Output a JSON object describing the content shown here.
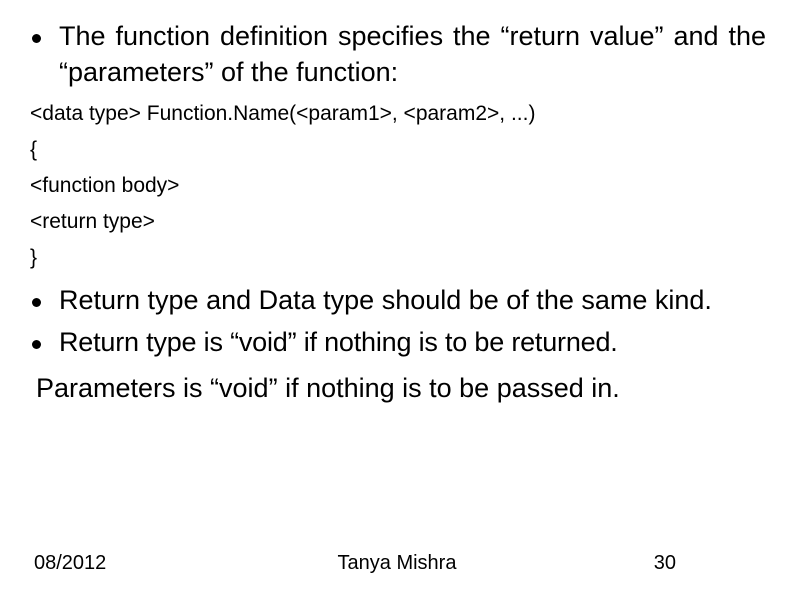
{
  "bullets": {
    "b1": "The function definition specifies the “return value” and the “parameters” of the function:",
    "b2": "Return type and Data type should be of the same kind.",
    "b3": "Return type is “void” if nothing is to be returned."
  },
  "code": {
    "l1": "<data type> Function.Name(<param1>, <param2>, ...)",
    "l2": "{",
    "l3": "<function body>",
    "l4": "<return type>",
    "l5": "}"
  },
  "last_para": "Parameters is “void” if nothing is to be passed in.",
  "footer": {
    "date": "08/2012",
    "author": "Tanya Mishra",
    "page": "30"
  }
}
